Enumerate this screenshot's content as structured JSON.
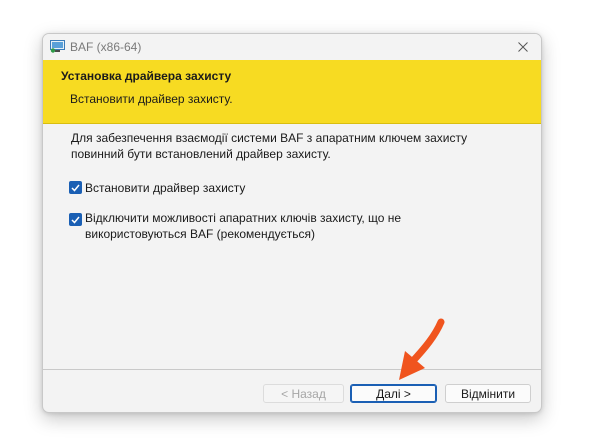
{
  "window": {
    "title": "BAF (x86-64)",
    "close_icon": "close-icon"
  },
  "banner": {
    "title": "Установка драйвера захисту",
    "subtitle": "Встановити драйвер захисту."
  },
  "content": {
    "description": "Для забезпечення взаємодії системи BAF з апаратним ключем захисту повинний бути встановлений драйвер захисту.",
    "options": [
      {
        "label": "Встановити драйвер захисту",
        "checked": true
      },
      {
        "label": "Відключити можливості апаратних ключів захисту, що не використовуються BAF (рекомендується)",
        "checked": true
      }
    ]
  },
  "buttons": {
    "back": "< Назад",
    "next": "Далі >",
    "cancel": "Відмінити"
  },
  "colors": {
    "banner": "#f7db22",
    "checkbox": "#1a5fb4",
    "arrow": "#f0541e"
  },
  "annotation_icon": "arrow-pointer-icon"
}
